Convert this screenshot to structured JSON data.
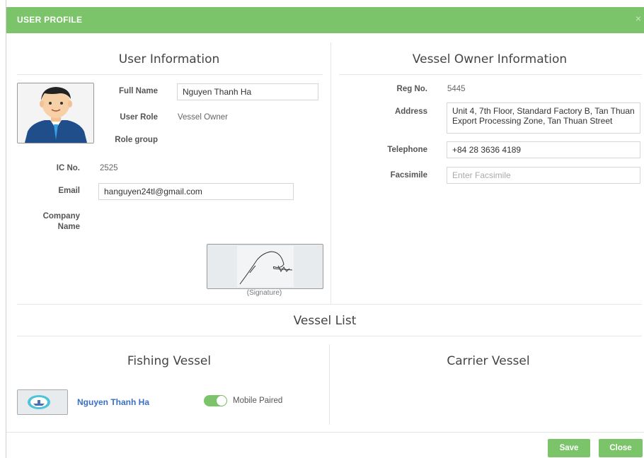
{
  "modal": {
    "title": "USER PROFILE",
    "close_icon": "×"
  },
  "user_info": {
    "section_title": "User Information",
    "full_name_label": "Full Name",
    "full_name_value": "Nguyen Thanh Ha",
    "user_role_label": "User Role",
    "user_role_value": "Vessel Owner",
    "role_group_label": "Role group",
    "ic_no_label": "IC No.",
    "ic_no_value": "2525",
    "email_label": "Email",
    "email_value": "hanguyen24tl@gmail.com",
    "company_label_line1": "Company",
    "company_label_line2": "Name",
    "signature_caption": "(Signature)"
  },
  "owner_info": {
    "section_title": "Vessel Owner Information",
    "reg_no_label": "Reg No.",
    "reg_no_value": "5445",
    "address_label": "Address",
    "address_value": "Unit 4, 7th Floor, Standard Factory B, Tan Thuan Export Processing Zone, Tan Thuan Street",
    "telephone_label": "Telephone",
    "telephone_value": "+84 28 3636 4189",
    "facsimile_label": "Facsimile",
    "facsimile_placeholder": "Enter Facsimile"
  },
  "vessel_list": {
    "title": "Vessel List",
    "fishing_title": "Fishing Vessel",
    "carrier_title": "Carrier Vessel",
    "fishing_items": [
      {
        "name": "Nguyen Thanh Ha",
        "status_label": "Mobile Paired",
        "paired": true
      }
    ]
  },
  "footer": {
    "save_label": "Save",
    "close_label": "Close"
  },
  "colors": {
    "accent": "#7cc46a",
    "link": "#3a6fc4"
  }
}
